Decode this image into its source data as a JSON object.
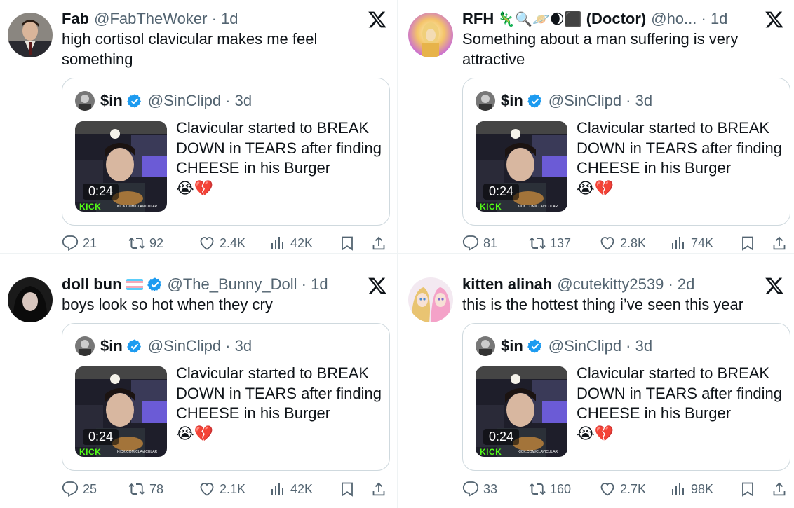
{
  "tweets": [
    {
      "name": "Fab",
      "handle": "@FabTheWoker",
      "time": "1d",
      "name_emojis": "",
      "verified": false,
      "flag": false,
      "text": "high cortisol clavicular makes me feel something",
      "stats": {
        "replies": "21",
        "retweets": "92",
        "likes": "2.4K",
        "views": "42K"
      },
      "avatar_icon": "avatar-man-suit"
    },
    {
      "name": "RFH",
      "handle": "@ho...",
      "time": "1d",
      "name_emojis": "🦎🔍🪐🌒⬛",
      "name_suffix": "(Doctor)",
      "verified": false,
      "flag": false,
      "text": "Something about a man suffering is very attractive",
      "stats": {
        "replies": "81",
        "retweets": "137",
        "likes": "2.8K",
        "views": "74K"
      },
      "avatar_icon": "avatar-golden-figure"
    },
    {
      "name": "doll bun",
      "handle": "@The_Bunny_Doll",
      "time": "1d",
      "name_emojis": "",
      "verified": true,
      "flag": true,
      "text": "boys look so hot when they cry",
      "stats": {
        "replies": "25",
        "retweets": "78",
        "likes": "2.1K",
        "views": "42K"
      },
      "avatar_icon": "avatar-dark-hair"
    },
    {
      "name": "kitten alinah",
      "handle": "@cutekitty2539",
      "time": "2d",
      "name_emojis": "",
      "verified": false,
      "flag": false,
      "text": "this is the hottest thing i’ve seen this year",
      "stats": {
        "replies": "33",
        "retweets": "160",
        "likes": "2.7K",
        "views": "98K"
      },
      "avatar_icon": "avatar-anime"
    }
  ],
  "quote": {
    "name": "$in",
    "handle": "@SinClipd",
    "time": "3d",
    "text": "Clavicular started to BREAK DOWN in TEARS after finding CHEESE in his Burger",
    "emoji": "😭💔",
    "duration": "0:24",
    "kick_label": "KICK",
    "kick_url": "KICK.COM/CLAVICULAR"
  },
  "colors": {
    "text": "#0f1419",
    "muted": "#536471",
    "verified": "#1d9bf0",
    "border": "#cfd9de",
    "kick_green": "#53fc18"
  }
}
